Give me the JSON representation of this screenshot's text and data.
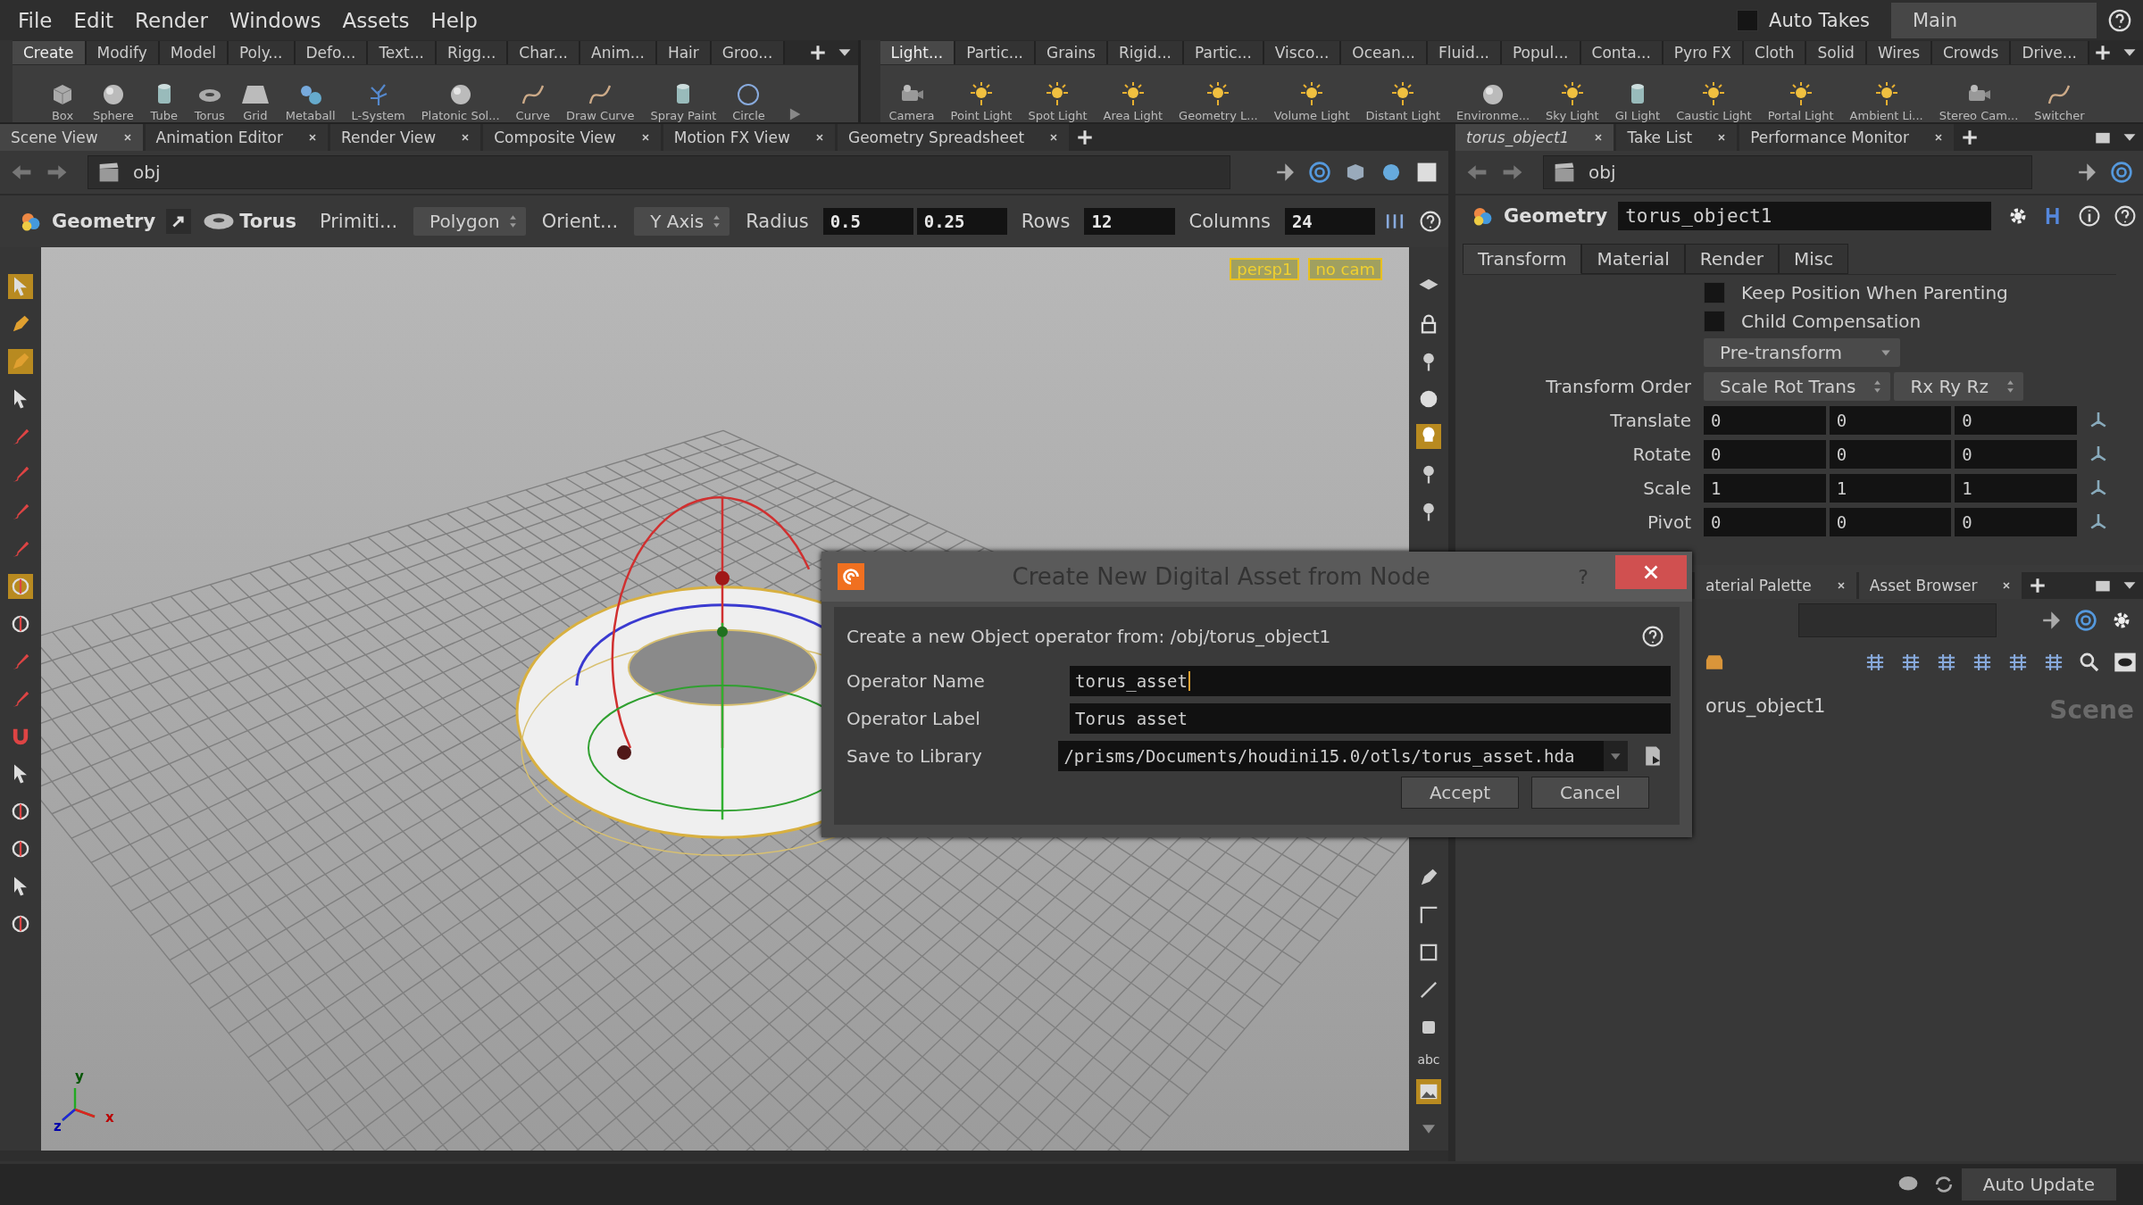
{
  "menu": [
    "File",
    "Edit",
    "Render",
    "Windows",
    "Assets",
    "Help"
  ],
  "auto_takes": {
    "label": "Auto Takes",
    "checked": false
  },
  "desktop": {
    "value": "Main"
  },
  "shelf_left": {
    "tabs": [
      {
        "label": "Create",
        "selected": true
      },
      {
        "label": "Modify",
        "selected": false
      },
      {
        "label": "Model",
        "selected": false
      },
      {
        "label": "Poly...",
        "selected": false
      },
      {
        "label": "Defo...",
        "selected": false
      },
      {
        "label": "Text...",
        "selected": false
      },
      {
        "label": "Rigg...",
        "selected": false
      },
      {
        "label": "Char...",
        "selected": false
      },
      {
        "label": "Anim...",
        "selected": false
      },
      {
        "label": "Hair",
        "selected": false
      },
      {
        "label": "Groo...",
        "selected": false
      }
    ],
    "tools": [
      {
        "label": "Box",
        "kind": "cube"
      },
      {
        "label": "Sphere",
        "kind": "sphere"
      },
      {
        "label": "Tube",
        "kind": "cylinder"
      },
      {
        "label": "Torus",
        "kind": "torus"
      },
      {
        "label": "Grid",
        "kind": "plane"
      },
      {
        "label": "Metaball",
        "kind": "blob"
      },
      {
        "label": "L-System",
        "kind": "tree"
      },
      {
        "label": "Platonic Sol...",
        "kind": "sphere"
      },
      {
        "label": "Curve",
        "kind": "curve"
      },
      {
        "label": "Draw Curve",
        "kind": "curve"
      },
      {
        "label": "Spray Paint",
        "kind": "cylinder"
      },
      {
        "label": "Circle",
        "kind": "ring"
      }
    ]
  },
  "shelf_right": {
    "tabs": [
      {
        "label": "Light...",
        "selected": true
      },
      {
        "label": "Partic...",
        "selected": false
      },
      {
        "label": "Grains",
        "selected": false
      },
      {
        "label": "Rigid...",
        "selected": false
      },
      {
        "label": "Partic...",
        "selected": false
      },
      {
        "label": "Visco...",
        "selected": false
      },
      {
        "label": "Ocean...",
        "selected": false
      },
      {
        "label": "Fluid...",
        "selected": false
      },
      {
        "label": "Popul...",
        "selected": false
      },
      {
        "label": "Conta...",
        "selected": false
      },
      {
        "label": "Pyro FX",
        "selected": false
      },
      {
        "label": "Cloth",
        "selected": false
      },
      {
        "label": "Solid",
        "selected": false
      },
      {
        "label": "Wires",
        "selected": false
      },
      {
        "label": "Crowds",
        "selected": false
      },
      {
        "label": "Drive...",
        "selected": false
      }
    ],
    "tools": [
      {
        "label": "Camera",
        "kind": "camera"
      },
      {
        "label": "Point Light",
        "kind": "light"
      },
      {
        "label": "Spot Light",
        "kind": "light"
      },
      {
        "label": "Area Light",
        "kind": "light"
      },
      {
        "label": "Geometry L...",
        "kind": "light"
      },
      {
        "label": "Volume Light",
        "kind": "light"
      },
      {
        "label": "Distant Light",
        "kind": "light"
      },
      {
        "label": "Environme...",
        "kind": "sphere"
      },
      {
        "label": "Sky Light",
        "kind": "light"
      },
      {
        "label": "GI Light",
        "kind": "cylinder"
      },
      {
        "label": "Caustic Light",
        "kind": "light"
      },
      {
        "label": "Portal Light",
        "kind": "light"
      },
      {
        "label": "Ambient Li...",
        "kind": "light"
      },
      {
        "label": "Stereo Cam...",
        "kind": "camera"
      },
      {
        "label": "Switcher",
        "kind": "curve"
      }
    ]
  },
  "scene_pane": {
    "tabs": [
      {
        "label": "Scene View",
        "selected": true
      },
      {
        "label": "Animation Editor",
        "selected": false
      },
      {
        "label": "Render View",
        "selected": false
      },
      {
        "label": "Composite View",
        "selected": false
      },
      {
        "label": "Motion FX View",
        "selected": false
      },
      {
        "label": "Geometry Spreadsheet",
        "selected": false
      }
    ],
    "path": "obj",
    "node_type": "Geometry",
    "node": "Torus",
    "params": [
      {
        "kind": "label",
        "text": "Primiti..."
      },
      {
        "kind": "menu",
        "text": "Polygon"
      },
      {
        "kind": "label",
        "text": "Orient..."
      },
      {
        "kind": "menu",
        "text": "Y Axis"
      },
      {
        "kind": "label",
        "text": "Radius"
      },
      {
        "kind": "field",
        "text": "0.5"
      },
      {
        "kind": "field",
        "text": "0.25"
      },
      {
        "kind": "label",
        "text": "Rows"
      },
      {
        "kind": "field",
        "text": "12"
      },
      {
        "kind": "label",
        "text": "Columns"
      },
      {
        "kind": "field",
        "text": "24"
      }
    ],
    "camera": "persp1",
    "camera_menu": "no cam",
    "toolbar_text": "abc",
    "axes": [
      "x",
      "y",
      "z"
    ]
  },
  "param_pane": {
    "tabs": [
      {
        "label": "torus_object1",
        "selected": true
      },
      {
        "label": "Take List",
        "selected": false
      },
      {
        "label": "Performance Monitor",
        "selected": false
      }
    ],
    "path": "obj",
    "node_type": "Geometry",
    "node_name": "torus_object1",
    "param_tabs": [
      {
        "label": "Transform",
        "selected": true
      },
      {
        "label": "Material",
        "selected": false
      },
      {
        "label": "Render",
        "selected": false
      },
      {
        "label": "Misc",
        "selected": false
      }
    ],
    "checkboxes": [
      {
        "label": "Keep Position When Parenting",
        "checked": false
      },
      {
        "label": "Child Compensation",
        "checked": false
      }
    ],
    "pre_transform": "Pre-transform",
    "transform_order": {
      "label": "Transform Order",
      "menus": [
        "Scale Rot Trans",
        "Rx Ry Rz"
      ]
    },
    "vectors": [
      {
        "label": "Translate",
        "values": [
          "0",
          "0",
          "0"
        ]
      },
      {
        "label": "Rotate",
        "values": [
          "0",
          "0",
          "0"
        ]
      },
      {
        "label": "Scale",
        "values": [
          "1",
          "1",
          "1"
        ]
      },
      {
        "label": "Pivot",
        "values": [
          "0",
          "0",
          "0"
        ]
      }
    ]
  },
  "network_pane": {
    "tabs": [
      {
        "label": "aterial Palette",
        "selected": false
      },
      {
        "label": "Asset Browser",
        "selected": false
      }
    ],
    "node": "orus_object1",
    "context": "Scene"
  },
  "dialog": {
    "title": "Create New Digital Asset from Node",
    "help": "?",
    "message": "Create a new Object operator from: /obj/torus_object1",
    "fields": [
      {
        "label": "Operator Name",
        "value": "torus_asset",
        "kind": "text"
      },
      {
        "label": "Operator Label",
        "value": "Torus asset",
        "kind": "text"
      },
      {
        "label": "Save to Library",
        "value": "/prisms/Documents/houdini15.0/otls/torus_asset.hda",
        "kind": "file"
      }
    ],
    "buttons": [
      "Accept",
      "Cancel"
    ]
  },
  "status_bar": {
    "button": "Auto Update"
  }
}
